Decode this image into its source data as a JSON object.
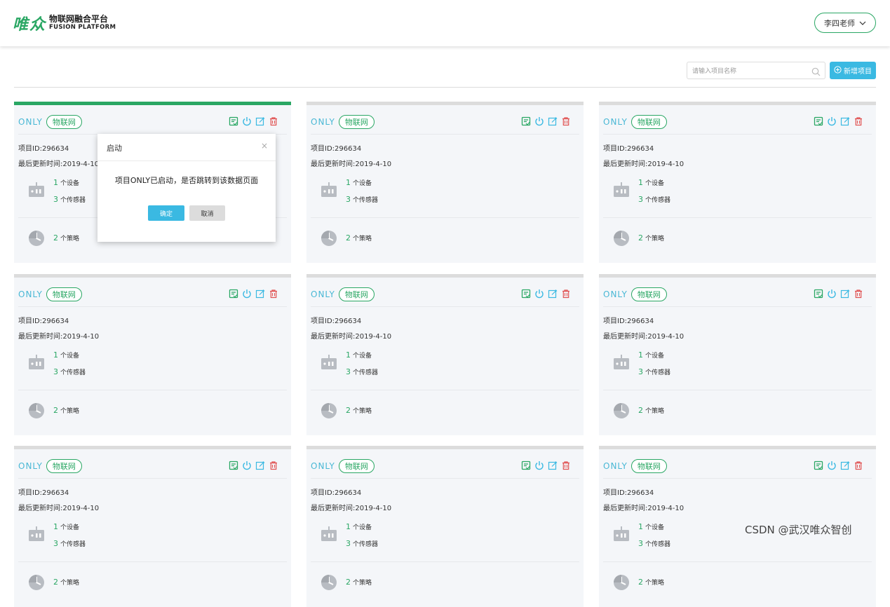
{
  "header": {
    "logo_mark": "唯众",
    "logo_cn": "物联网融合平台",
    "logo_en": "FUSION PLATFORM",
    "user_label": "李四老师",
    "user_dropdown_icon": "chevron-down-icon"
  },
  "toolbar": {
    "search_placeholder": "请输入项目名称",
    "new_button_label": "新增项目"
  },
  "colors": {
    "brand_green": "#2aa764",
    "accent_blue": "#3ab9e2",
    "danger_red": "#e05050"
  },
  "cards": [
    {
      "name": "ONLY",
      "tag": "物联网",
      "id_text": "项目ID:296634",
      "time_text": "最后更新时间:2019-4-10",
      "devices": "1",
      "devices_label": "个设备",
      "sensors": "3",
      "sensors_label": "个传感器",
      "policies": "2",
      "policies_label": "个策略",
      "active": true
    },
    {
      "name": "ONLY",
      "tag": "物联网",
      "id_text": "项目ID:296634",
      "time_text": "最后更新时间:2019-4-10",
      "devices": "1",
      "devices_label": "个设备",
      "sensors": "3",
      "sensors_label": "个传感器",
      "policies": "2",
      "policies_label": "个策略",
      "active": false
    },
    {
      "name": "ONLY",
      "tag": "物联网",
      "id_text": "项目ID:296634",
      "time_text": "最后更新时间:2019-4-10",
      "devices": "1",
      "devices_label": "个设备",
      "sensors": "3",
      "sensors_label": "个传感器",
      "policies": "2",
      "policies_label": "个策略",
      "active": false
    },
    {
      "name": "ONLY",
      "tag": "物联网",
      "id_text": "项目ID:296634",
      "time_text": "最后更新时间:2019-4-10",
      "devices": "1",
      "devices_label": "个设备",
      "sensors": "3",
      "sensors_label": "个传感器",
      "policies": "2",
      "policies_label": "个策略",
      "active": false
    },
    {
      "name": "ONLY",
      "tag": "物联网",
      "id_text": "项目ID:296634",
      "time_text": "最后更新时间:2019-4-10",
      "devices": "1",
      "devices_label": "个设备",
      "sensors": "3",
      "sensors_label": "个传感器",
      "policies": "2",
      "policies_label": "个策略",
      "active": false
    },
    {
      "name": "ONLY",
      "tag": "物联网",
      "id_text": "项目ID:296634",
      "time_text": "最后更新时间:2019-4-10",
      "devices": "1",
      "devices_label": "个设备",
      "sensors": "3",
      "sensors_label": "个传感器",
      "policies": "2",
      "policies_label": "个策略",
      "active": false
    },
    {
      "name": "ONLY",
      "tag": "物联网",
      "id_text": "项目ID:296634",
      "time_text": "最后更新时间:2019-4-10",
      "devices": "1",
      "devices_label": "个设备",
      "sensors": "3",
      "sensors_label": "个传感器",
      "policies": "2",
      "policies_label": "个策略",
      "active": false
    },
    {
      "name": "ONLY",
      "tag": "物联网",
      "id_text": "项目ID:296634",
      "time_text": "最后更新时间:2019-4-10",
      "devices": "1",
      "devices_label": "个设备",
      "sensors": "3",
      "sensors_label": "个传感器",
      "policies": "2",
      "policies_label": "个策略",
      "active": false
    },
    {
      "name": "ONLY",
      "tag": "物联网",
      "id_text": "项目ID:296634",
      "time_text": "最后更新时间:2019-4-10",
      "devices": "1",
      "devices_label": "个设备",
      "sensors": "3",
      "sensors_label": "个传感器",
      "policies": "2",
      "policies_label": "个策略",
      "active": false
    }
  ],
  "card_action_icons": [
    "data-page-icon",
    "power-icon",
    "edit-icon",
    "delete-icon"
  ],
  "modal": {
    "title": "启动",
    "close_glyph": "×",
    "message": "项目ONLY已启动，是否跳转到该数据页面",
    "ok_label": "确定",
    "cancel_label": "取消"
  },
  "watermark": "CSDN @武汉唯众智创"
}
